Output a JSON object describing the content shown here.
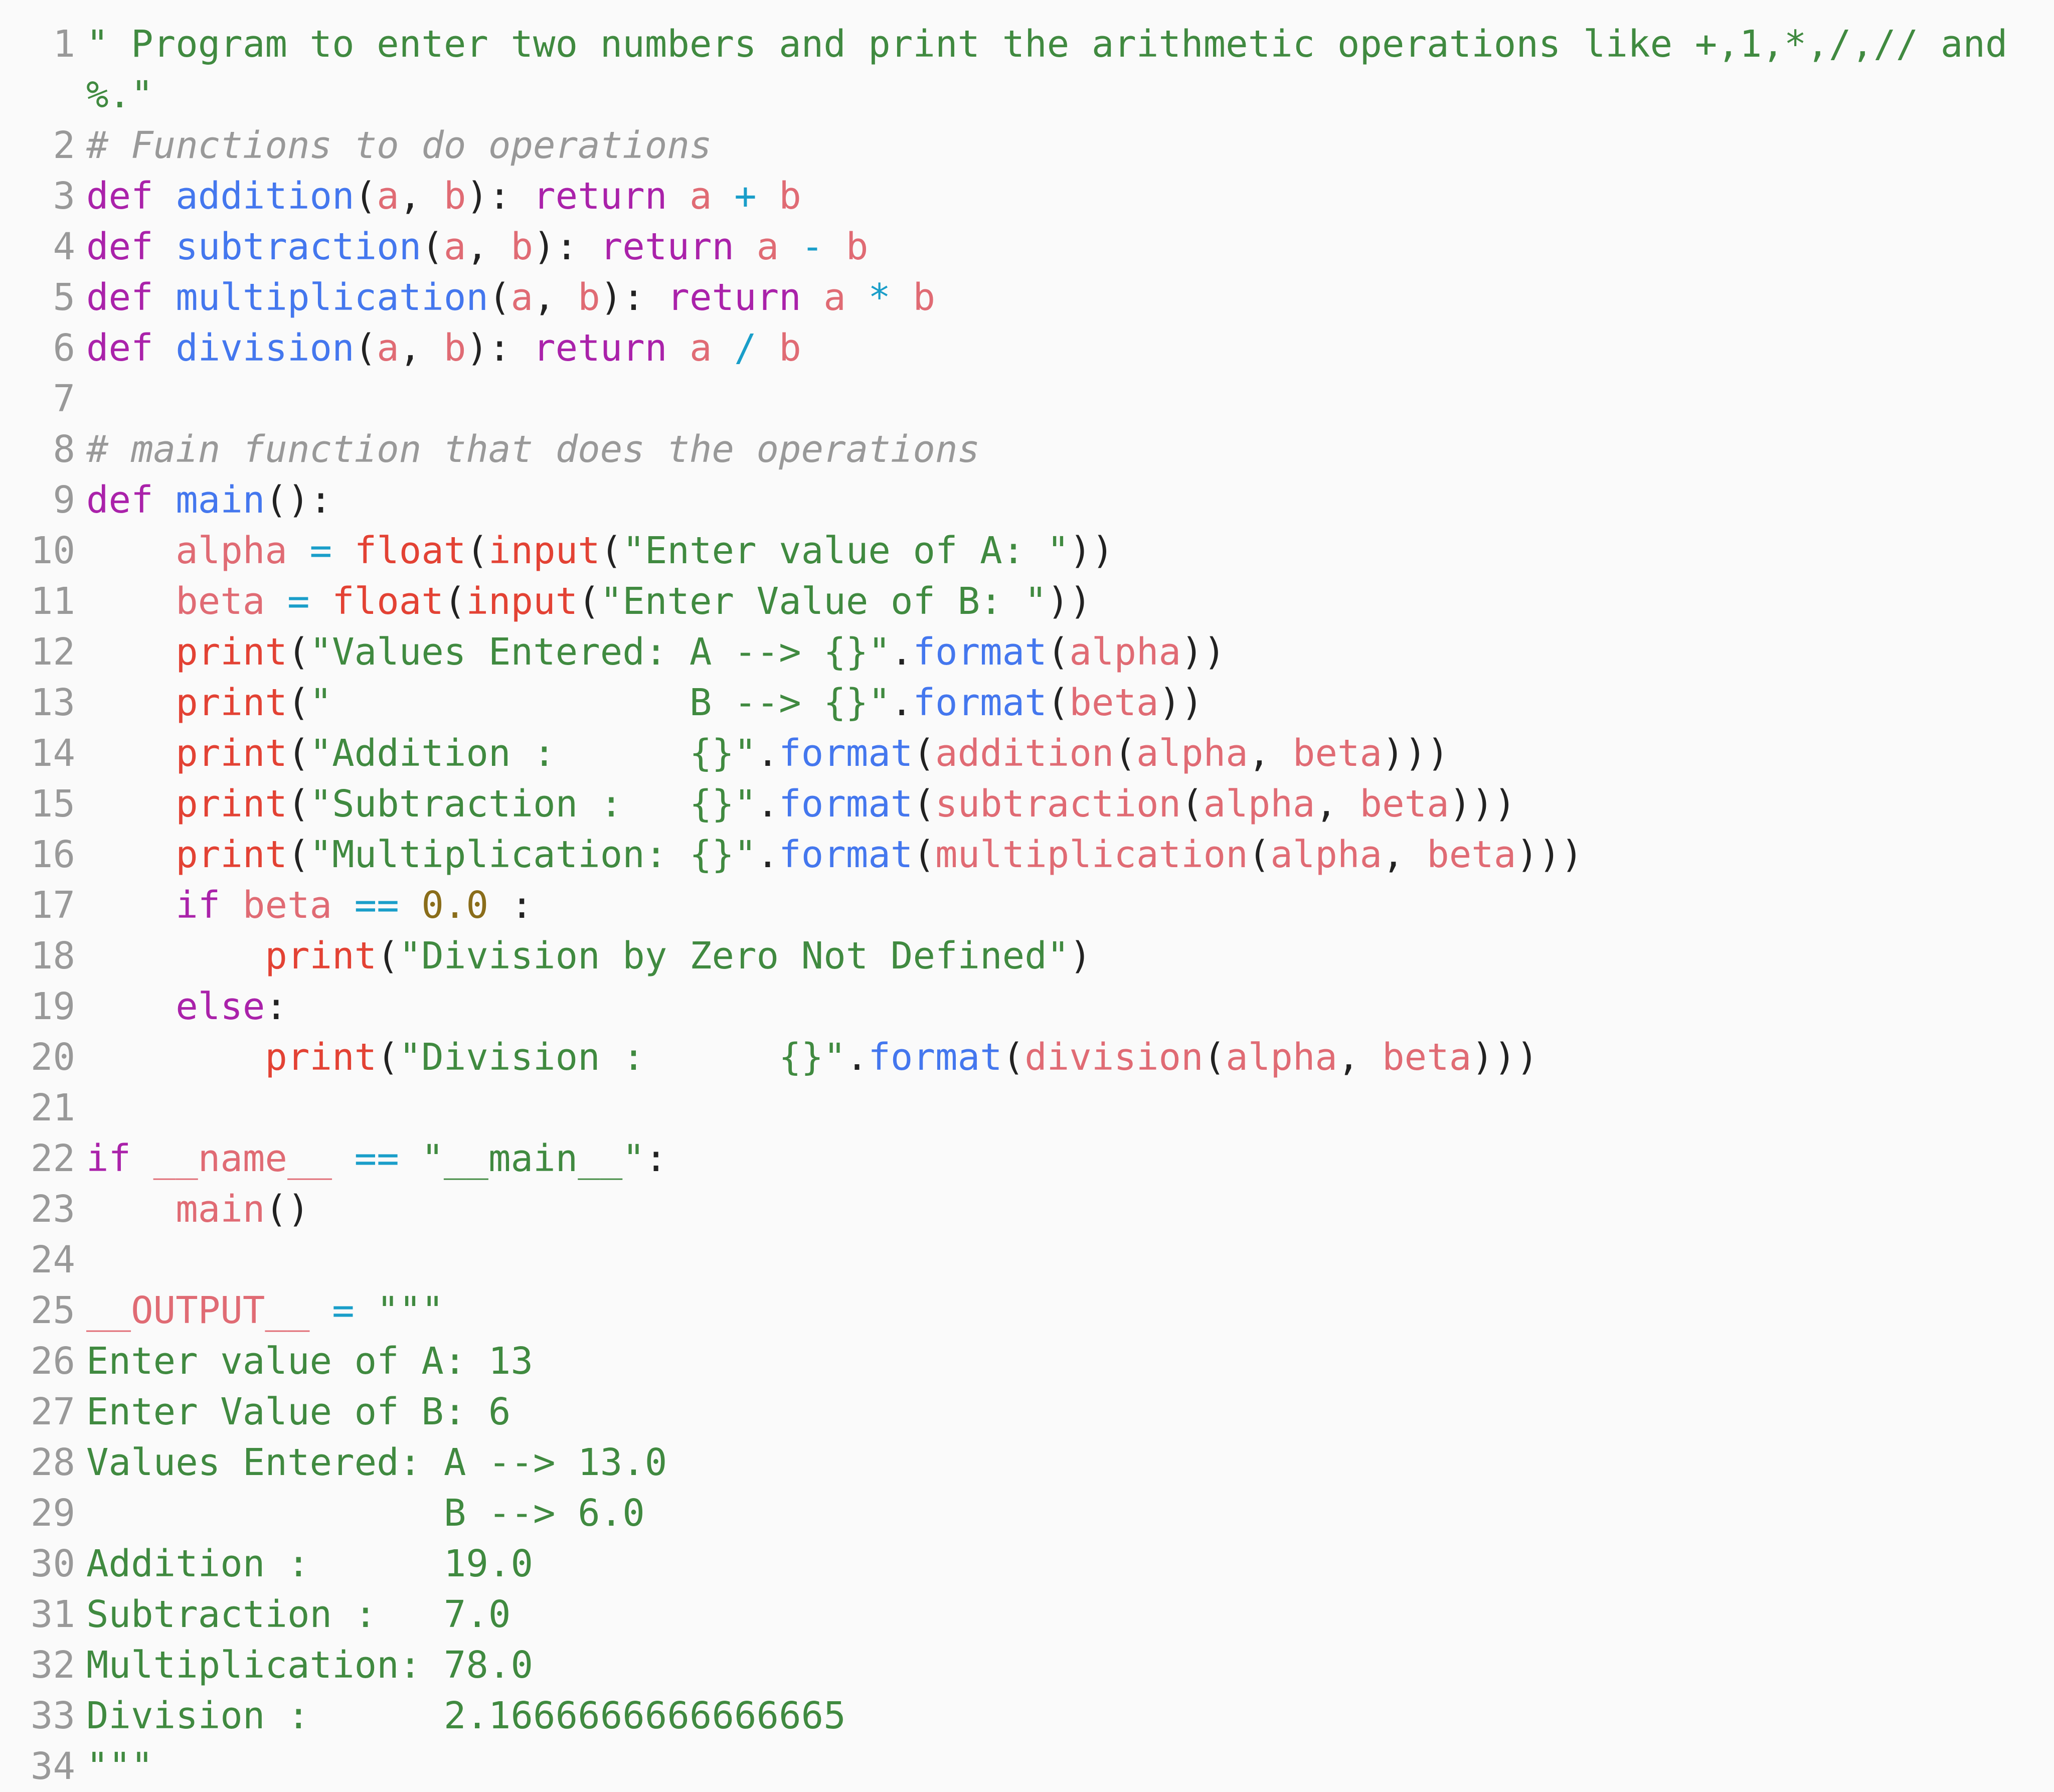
{
  "editor": {
    "language": "python",
    "background_color": "#fafafa",
    "line_number_color": "#999999",
    "total_lines": 34,
    "colors": {
      "string": "#408a40",
      "comment": "#999999",
      "keyword": "#aa22aa",
      "function": "#4477ee",
      "name": "#e06b74",
      "builtin": "#e34234",
      "operator": "#1a9ec9",
      "number": "#8a6d1a",
      "punctuation": "#222222"
    }
  },
  "lines": [
    {
      "n": "1",
      "text": "\" Program to enter two numbers and print the arithmetic operations like +,1,*,/,// and %.\""
    },
    {
      "n": "2",
      "text": "# Functions to do operations"
    },
    {
      "n": "3",
      "text": "def addition(a, b): return a + b"
    },
    {
      "n": "4",
      "text": "def subtraction(a, b): return a - b"
    },
    {
      "n": "5",
      "text": "def multiplication(a, b): return a * b"
    },
    {
      "n": "6",
      "text": "def division(a, b): return a / b"
    },
    {
      "n": "7",
      "text": ""
    },
    {
      "n": "8",
      "text": "# main function that does the operations"
    },
    {
      "n": "9",
      "text": "def main():"
    },
    {
      "n": "10",
      "text": "    alpha = float(input(\"Enter value of A: \"))"
    },
    {
      "n": "11",
      "text": "    beta = float(input(\"Enter Value of B: \"))"
    },
    {
      "n": "12",
      "text": "    print(\"Values Entered: A --> {}\".format(alpha))"
    },
    {
      "n": "13",
      "text": "    print(\"                B --> {}\".format(beta))"
    },
    {
      "n": "14",
      "text": "    print(\"Addition :      {}\".format(addition(alpha, beta)))"
    },
    {
      "n": "15",
      "text": "    print(\"Subtraction :   {}\".format(subtraction(alpha, beta)))"
    },
    {
      "n": "16",
      "text": "    print(\"Multiplication: {}\".format(multiplication(alpha, beta)))"
    },
    {
      "n": "17",
      "text": "    if beta == 0.0 :"
    },
    {
      "n": "18",
      "text": "        print(\"Division by Zero Not Defined\")"
    },
    {
      "n": "19",
      "text": "    else:"
    },
    {
      "n": "20",
      "text": "        print(\"Division :      {}\".format(division(alpha, beta)))"
    },
    {
      "n": "21",
      "text": ""
    },
    {
      "n": "22",
      "text": "if __name__ == \"__main__\":"
    },
    {
      "n": "23",
      "text": "    main()"
    },
    {
      "n": "24",
      "text": ""
    },
    {
      "n": "25",
      "text": "__OUTPUT__ = \"\"\""
    },
    {
      "n": "26",
      "text": "Enter value of A: 13"
    },
    {
      "n": "27",
      "text": "Enter Value of B: 6"
    },
    {
      "n": "28",
      "text": "Values Entered: A --> 13.0"
    },
    {
      "n": "29",
      "text": "                B --> 6.0"
    },
    {
      "n": "30",
      "text": "Addition :      19.0"
    },
    {
      "n": "31",
      "text": "Subtraction :   7.0"
    },
    {
      "n": "32",
      "text": "Multiplication: 78.0"
    },
    {
      "n": "33",
      "text": "Division :      2.1666666666666665"
    },
    {
      "n": "34",
      "text": "\"\"\""
    }
  ],
  "tokens": [
    [
      [
        "tok-str",
        "\" Program to enter two numbers and print the arithmetic operations like +,1,*,/,// and %.\""
      ]
    ],
    [
      [
        "tok-com",
        "# Functions to do operations"
      ]
    ],
    [
      [
        "tok-kw",
        "def"
      ],
      [
        "tok-pun",
        " "
      ],
      [
        "tok-fn",
        "addition"
      ],
      [
        "tok-pun",
        "("
      ],
      [
        "tok-name",
        "a"
      ],
      [
        "tok-pun",
        ", "
      ],
      [
        "tok-name",
        "b"
      ],
      [
        "tok-pun",
        "): "
      ],
      [
        "tok-kw",
        "return"
      ],
      [
        "tok-pun",
        " "
      ],
      [
        "tok-name",
        "a"
      ],
      [
        "tok-pun",
        " "
      ],
      [
        "tok-op",
        "+"
      ],
      [
        "tok-pun",
        " "
      ],
      [
        "tok-name",
        "b"
      ]
    ],
    [
      [
        "tok-kw",
        "def"
      ],
      [
        "tok-pun",
        " "
      ],
      [
        "tok-fn",
        "subtraction"
      ],
      [
        "tok-pun",
        "("
      ],
      [
        "tok-name",
        "a"
      ],
      [
        "tok-pun",
        ", "
      ],
      [
        "tok-name",
        "b"
      ],
      [
        "tok-pun",
        "): "
      ],
      [
        "tok-kw",
        "return"
      ],
      [
        "tok-pun",
        " "
      ],
      [
        "tok-name",
        "a"
      ],
      [
        "tok-pun",
        " "
      ],
      [
        "tok-op",
        "-"
      ],
      [
        "tok-pun",
        " "
      ],
      [
        "tok-name",
        "b"
      ]
    ],
    [
      [
        "tok-kw",
        "def"
      ],
      [
        "tok-pun",
        " "
      ],
      [
        "tok-fn",
        "multiplication"
      ],
      [
        "tok-pun",
        "("
      ],
      [
        "tok-name",
        "a"
      ],
      [
        "tok-pun",
        ", "
      ],
      [
        "tok-name",
        "b"
      ],
      [
        "tok-pun",
        "): "
      ],
      [
        "tok-kw",
        "return"
      ],
      [
        "tok-pun",
        " "
      ],
      [
        "tok-name",
        "a"
      ],
      [
        "tok-pun",
        " "
      ],
      [
        "tok-op",
        "*"
      ],
      [
        "tok-pun",
        " "
      ],
      [
        "tok-name",
        "b"
      ]
    ],
    [
      [
        "tok-kw",
        "def"
      ],
      [
        "tok-pun",
        " "
      ],
      [
        "tok-fn",
        "division"
      ],
      [
        "tok-pun",
        "("
      ],
      [
        "tok-name",
        "a"
      ],
      [
        "tok-pun",
        ", "
      ],
      [
        "tok-name",
        "b"
      ],
      [
        "tok-pun",
        "): "
      ],
      [
        "tok-kw",
        "return"
      ],
      [
        "tok-pun",
        " "
      ],
      [
        "tok-name",
        "a"
      ],
      [
        "tok-pun",
        " "
      ],
      [
        "tok-op",
        "/"
      ],
      [
        "tok-pun",
        " "
      ],
      [
        "tok-name",
        "b"
      ]
    ],
    [],
    [
      [
        "tok-com",
        "# main function that does the operations"
      ]
    ],
    [
      [
        "tok-kw",
        "def"
      ],
      [
        "tok-pun",
        " "
      ],
      [
        "tok-fn",
        "main"
      ],
      [
        "tok-pun",
        "():"
      ]
    ],
    [
      [
        "tok-pun",
        "    "
      ],
      [
        "tok-name",
        "alpha"
      ],
      [
        "tok-pun",
        " "
      ],
      [
        "tok-op",
        "="
      ],
      [
        "tok-pun",
        " "
      ],
      [
        "tok-bi",
        "float"
      ],
      [
        "tok-pun",
        "("
      ],
      [
        "tok-bi",
        "input"
      ],
      [
        "tok-pun",
        "("
      ],
      [
        "tok-str",
        "\"Enter value of A: \""
      ],
      [
        "tok-pun",
        "))"
      ]
    ],
    [
      [
        "tok-pun",
        "    "
      ],
      [
        "tok-name",
        "beta"
      ],
      [
        "tok-pun",
        " "
      ],
      [
        "tok-op",
        "="
      ],
      [
        "tok-pun",
        " "
      ],
      [
        "tok-bi",
        "float"
      ],
      [
        "tok-pun",
        "("
      ],
      [
        "tok-bi",
        "input"
      ],
      [
        "tok-pun",
        "("
      ],
      [
        "tok-str",
        "\"Enter Value of B: \""
      ],
      [
        "tok-pun",
        "))"
      ]
    ],
    [
      [
        "tok-pun",
        "    "
      ],
      [
        "tok-bi",
        "print"
      ],
      [
        "tok-pun",
        "("
      ],
      [
        "tok-str",
        "\"Values Entered: A --> {}\""
      ],
      [
        "tok-pun",
        "."
      ],
      [
        "tok-fn",
        "format"
      ],
      [
        "tok-pun",
        "("
      ],
      [
        "tok-name",
        "alpha"
      ],
      [
        "tok-pun",
        "))"
      ]
    ],
    [
      [
        "tok-pun",
        "    "
      ],
      [
        "tok-bi",
        "print"
      ],
      [
        "tok-pun",
        "("
      ],
      [
        "tok-str",
        "\"                B --> {}\""
      ],
      [
        "tok-pun",
        "."
      ],
      [
        "tok-fn",
        "format"
      ],
      [
        "tok-pun",
        "("
      ],
      [
        "tok-name",
        "beta"
      ],
      [
        "tok-pun",
        "))"
      ]
    ],
    [
      [
        "tok-pun",
        "    "
      ],
      [
        "tok-bi",
        "print"
      ],
      [
        "tok-pun",
        "("
      ],
      [
        "tok-str",
        "\"Addition :      {}\""
      ],
      [
        "tok-pun",
        "."
      ],
      [
        "tok-fn",
        "format"
      ],
      [
        "tok-pun",
        "("
      ],
      [
        "tok-name",
        "addition"
      ],
      [
        "tok-pun",
        "("
      ],
      [
        "tok-name",
        "alpha"
      ],
      [
        "tok-pun",
        ", "
      ],
      [
        "tok-name",
        "beta"
      ],
      [
        "tok-pun",
        ")))"
      ]
    ],
    [
      [
        "tok-pun",
        "    "
      ],
      [
        "tok-bi",
        "print"
      ],
      [
        "tok-pun",
        "("
      ],
      [
        "tok-str",
        "\"Subtraction :   {}\""
      ],
      [
        "tok-pun",
        "."
      ],
      [
        "tok-fn",
        "format"
      ],
      [
        "tok-pun",
        "("
      ],
      [
        "tok-name",
        "subtraction"
      ],
      [
        "tok-pun",
        "("
      ],
      [
        "tok-name",
        "alpha"
      ],
      [
        "tok-pun",
        ", "
      ],
      [
        "tok-name",
        "beta"
      ],
      [
        "tok-pun",
        ")))"
      ]
    ],
    [
      [
        "tok-pun",
        "    "
      ],
      [
        "tok-bi",
        "print"
      ],
      [
        "tok-pun",
        "("
      ],
      [
        "tok-str",
        "\"Multiplication: {}\""
      ],
      [
        "tok-pun",
        "."
      ],
      [
        "tok-fn",
        "format"
      ],
      [
        "tok-pun",
        "("
      ],
      [
        "tok-name",
        "multiplication"
      ],
      [
        "tok-pun",
        "("
      ],
      [
        "tok-name",
        "alpha"
      ],
      [
        "tok-pun",
        ", "
      ],
      [
        "tok-name",
        "beta"
      ],
      [
        "tok-pun",
        ")))"
      ]
    ],
    [
      [
        "tok-pun",
        "    "
      ],
      [
        "tok-kw",
        "if"
      ],
      [
        "tok-pun",
        " "
      ],
      [
        "tok-name",
        "beta"
      ],
      [
        "tok-pun",
        " "
      ],
      [
        "tok-op",
        "=="
      ],
      [
        "tok-pun",
        " "
      ],
      [
        "tok-num",
        "0.0"
      ],
      [
        "tok-pun",
        " :"
      ]
    ],
    [
      [
        "tok-pun",
        "        "
      ],
      [
        "tok-bi",
        "print"
      ],
      [
        "tok-pun",
        "("
      ],
      [
        "tok-str",
        "\"Division by Zero Not Defined\""
      ],
      [
        "tok-pun",
        ")"
      ]
    ],
    [
      [
        "tok-pun",
        "    "
      ],
      [
        "tok-kw",
        "else"
      ],
      [
        "tok-pun",
        ":"
      ]
    ],
    [
      [
        "tok-pun",
        "        "
      ],
      [
        "tok-bi",
        "print"
      ],
      [
        "tok-pun",
        "("
      ],
      [
        "tok-str",
        "\"Division :      {}\""
      ],
      [
        "tok-pun",
        "."
      ],
      [
        "tok-fn",
        "format"
      ],
      [
        "tok-pun",
        "("
      ],
      [
        "tok-name",
        "division"
      ],
      [
        "tok-pun",
        "("
      ],
      [
        "tok-name",
        "alpha"
      ],
      [
        "tok-pun",
        ", "
      ],
      [
        "tok-name",
        "beta"
      ],
      [
        "tok-pun",
        ")))"
      ]
    ],
    [],
    [
      [
        "tok-kw",
        "if"
      ],
      [
        "tok-pun",
        " "
      ],
      [
        "tok-name",
        "__name__"
      ],
      [
        "tok-pun",
        " "
      ],
      [
        "tok-op",
        "=="
      ],
      [
        "tok-pun",
        " "
      ],
      [
        "tok-str",
        "\"__main__\""
      ],
      [
        "tok-pun",
        ":"
      ]
    ],
    [
      [
        "tok-pun",
        "    "
      ],
      [
        "tok-name",
        "main"
      ],
      [
        "tok-pun",
        "()"
      ]
    ],
    [],
    [
      [
        "tok-name",
        "__OUTPUT__"
      ],
      [
        "tok-pun",
        " "
      ],
      [
        "tok-op",
        "="
      ],
      [
        "tok-pun",
        " "
      ],
      [
        "tok-str",
        "\"\"\""
      ]
    ],
    [
      [
        "tok-str",
        "Enter value of A: 13"
      ]
    ],
    [
      [
        "tok-str",
        "Enter Value of B: 6"
      ]
    ],
    [
      [
        "tok-str",
        "Values Entered: A --> 13.0"
      ]
    ],
    [
      [
        "tok-str",
        "                B --> 6.0"
      ]
    ],
    [
      [
        "tok-str",
        "Addition :      19.0"
      ]
    ],
    [
      [
        "tok-str",
        "Subtraction :   7.0"
      ]
    ],
    [
      [
        "tok-str",
        "Multiplication: 78.0"
      ]
    ],
    [
      [
        "tok-str",
        "Division :      2.1666666666666665"
      ]
    ],
    [
      [
        "tok-str",
        "\"\"\""
      ]
    ]
  ]
}
